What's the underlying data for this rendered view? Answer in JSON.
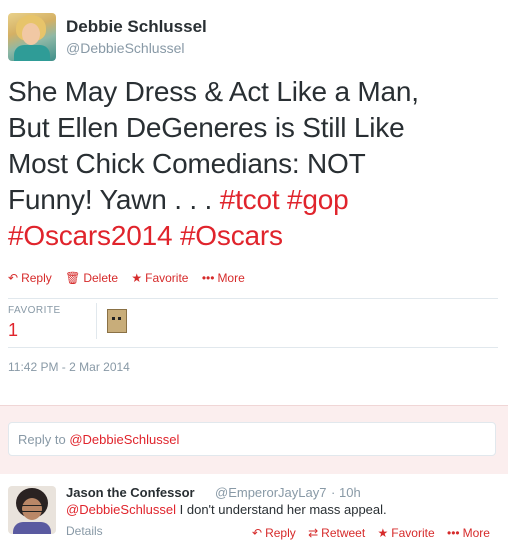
{
  "tweet": {
    "user_name": "Debbie Schlussel",
    "user_handle": "@DebbieSchlussel",
    "text_line1": "She May Dress & Act Like a Man,",
    "text_line2": "But Ellen DeGeneres is Still Like",
    "text_line3": "Most Chick Comedians: NOT",
    "text_line4_plain": "Funny! Yawn . . . ",
    "hashtags": [
      "#tcot",
      "#gop",
      "#Oscars2014",
      "#Oscars"
    ],
    "actions": {
      "reply": "Reply",
      "delete": "Delete",
      "favorite": "Favorite",
      "more": "More"
    },
    "icons": {
      "reply": "↶",
      "delete": "🗑",
      "favorite": "★",
      "more": "•••"
    },
    "stats": {
      "label": "FAVORITE",
      "value": "1"
    },
    "timestamp": "11:42 PM - 2 Mar 2014"
  },
  "reply_input": {
    "prefix": "Reply to ",
    "mention": "@DebbieSchlussel"
  },
  "reply": {
    "user_name": "Jason the Confessor",
    "user_handle": "@EmperorJayLay7",
    "dot": "·",
    "time": "10h",
    "mention": "@DebbieSchlussel",
    "text": " I don't understand her mass appeal.",
    "details": "Details",
    "actions": {
      "reply": "Reply",
      "retweet": "Retweet",
      "favorite": "Favorite",
      "more": "More"
    },
    "icons": {
      "reply": "↶",
      "retweet": "⇄",
      "favorite": "★",
      "more": "•••"
    }
  },
  "colors": {
    "accent": "#e0242c",
    "muted": "#8899a6",
    "text": "#292f33",
    "reply_bg": "#fbeeee"
  }
}
